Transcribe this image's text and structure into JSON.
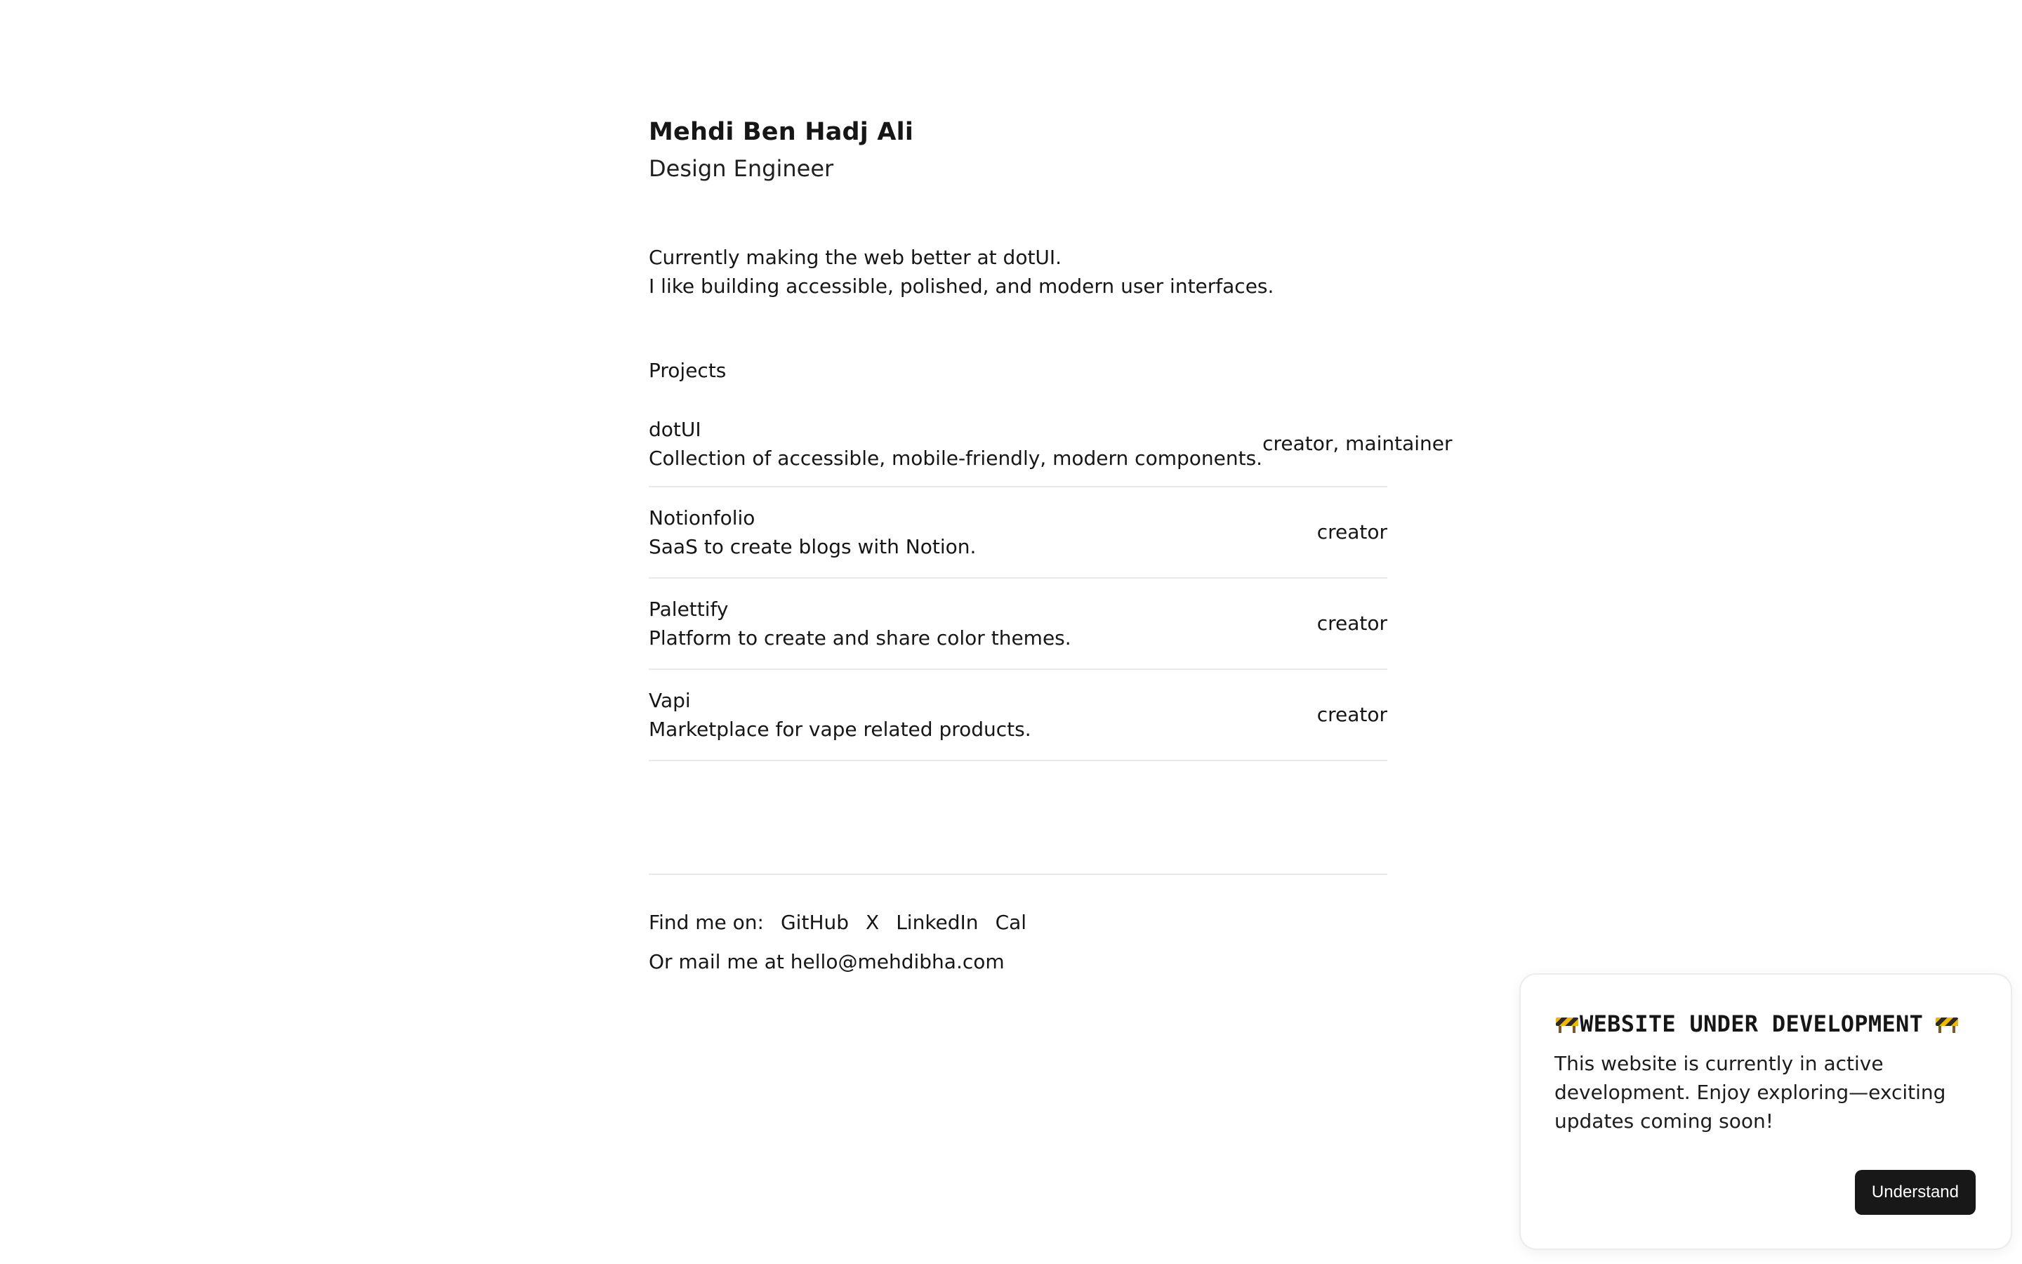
{
  "header": {
    "name": "Mehdi Ben Hadj Ali",
    "role": "Design Engineer"
  },
  "bio": {
    "line1": "Currently making the web better at dotUI.",
    "line2": "I like building accessible, polished, and modern user interfaces."
  },
  "projects": {
    "heading": "Projects",
    "items": [
      {
        "name": "dotUI",
        "description": "Collection of accessible, mobile-friendly, modern components.",
        "role": "creator, maintainer"
      },
      {
        "name": "Notionfolio",
        "description": "SaaS to create blogs with Notion.",
        "role": "creator"
      },
      {
        "name": "Palettify",
        "description": "Platform to create and share color themes.",
        "role": "creator"
      },
      {
        "name": "Vapi",
        "description": "Marketplace for vape related products.",
        "role": "creator"
      }
    ]
  },
  "footer": {
    "find_label": "Find me on:",
    "links": [
      "GitHub",
      "X",
      "LinkedIn",
      "Cal"
    ],
    "mail_prefix": "Or mail me at",
    "email": "hello@mehdibha.com"
  },
  "notice": {
    "title": "WEBSITE UNDER DEVELOPMENT",
    "icon": "construction-barrier-icon",
    "body": "This website is currently in active development. Enjoy exploring—exciting updates coming soon!",
    "button_label": "Understand",
    "button_color": "#181818"
  }
}
